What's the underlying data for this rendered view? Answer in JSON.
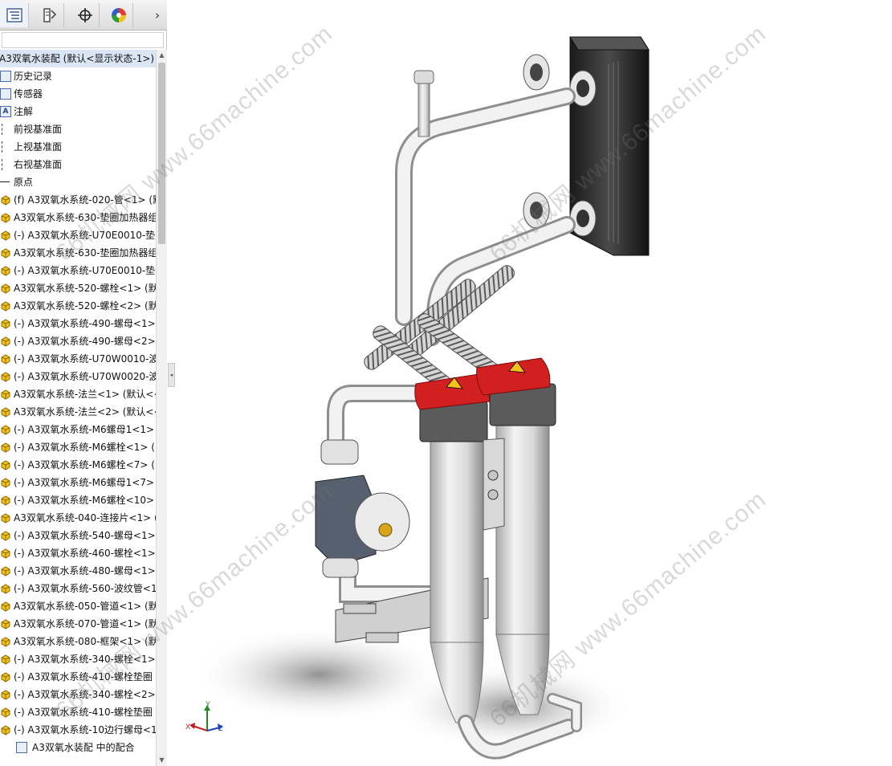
{
  "toolbar": {
    "buttons": [
      {
        "name": "feature-manager-tab",
        "icon": "tree-list-icon"
      },
      {
        "name": "property-manager-tab",
        "icon": "property-icon"
      },
      {
        "name": "configuration-manager-tab",
        "icon": "crosshair-icon"
      },
      {
        "name": "display-manager-tab",
        "icon": "color-wheel-icon"
      }
    ],
    "more_label": "›"
  },
  "tree": {
    "root": "A3双氧水装配  (默认<显示状态-1>)",
    "items": [
      {
        "icon": "history",
        "label": "历史记录"
      },
      {
        "icon": "sensor",
        "label": "传感器"
      },
      {
        "icon": "annotation",
        "label": "注解"
      },
      {
        "icon": "plane",
        "label": "前视基准面"
      },
      {
        "icon": "plane",
        "label": "上视基准面"
      },
      {
        "icon": "plane",
        "label": "右视基准面"
      },
      {
        "icon": "origin",
        "label": "原点"
      },
      {
        "icon": "part",
        "label": "(f) A3双氧水系统-020-管<1> (默"
      },
      {
        "icon": "part",
        "label": "A3双氧水系统-630-垫圈加热器组"
      },
      {
        "icon": "part",
        "label": "(-) A3双氧水系统-U70E0010-垫"
      },
      {
        "icon": "part",
        "label": "A3双氧水系统-630-垫圈加热器组"
      },
      {
        "icon": "part",
        "label": "(-) A3双氧水系统-U70E0010-垫"
      },
      {
        "icon": "part",
        "label": "A3双氧水系统-520-螺栓<1> (默"
      },
      {
        "icon": "part",
        "label": "A3双氧水系统-520-螺栓<2> (默"
      },
      {
        "icon": "part",
        "label": "(-) A3双氧水系统-490-螺母<1>"
      },
      {
        "icon": "part",
        "label": "(-) A3双氧水系统-490-螺母<2>"
      },
      {
        "icon": "part",
        "label": "(-) A3双氧水系统-U70W0010-波"
      },
      {
        "icon": "part",
        "label": "(-) A3双氧水系统-U70W0020-波"
      },
      {
        "icon": "part",
        "label": "A3双氧水系统-法兰<1> (默认<<"
      },
      {
        "icon": "part",
        "label": "A3双氧水系统-法兰<2> (默认<<"
      },
      {
        "icon": "part",
        "label": "(-) A3双氧水系统-M6螺母1<1>"
      },
      {
        "icon": "part",
        "label": "(-) A3双氧水系统-M6螺栓<1> ("
      },
      {
        "icon": "part",
        "label": "(-) A3双氧水系统-M6螺栓<7> ("
      },
      {
        "icon": "part",
        "label": "(-) A3双氧水系统-M6螺母1<7>"
      },
      {
        "icon": "part",
        "label": "(-) A3双氧水系统-M6螺栓<10>"
      },
      {
        "icon": "part",
        "label": "A3双氧水系统-040-连接片<1> ("
      },
      {
        "icon": "part",
        "label": "(-) A3双氧水系统-540-螺母<1>"
      },
      {
        "icon": "part",
        "label": "(-) A3双氧水系统-460-螺栓<1>"
      },
      {
        "icon": "part",
        "label": "(-) A3双氧水系统-480-螺母<1>"
      },
      {
        "icon": "part",
        "label": "(-) A3双氧水系统-560-波纹管<1"
      },
      {
        "icon": "part",
        "label": "A3双氧水系统-050-管道<1> (默"
      },
      {
        "icon": "part",
        "label": "A3双氧水系统-070-管道<1> (默"
      },
      {
        "icon": "part",
        "label": "A3双氧水系统-080-框架<1> (默"
      },
      {
        "icon": "part",
        "label": "(-) A3双氧水系统-340-螺栓<1>"
      },
      {
        "icon": "part",
        "label": "(-) A3双氧水系统-410-螺栓垫圈"
      },
      {
        "icon": "part",
        "label": "(-) A3双氧水系统-340-螺栓<2>"
      },
      {
        "icon": "part",
        "label": "(-) A3双氧水系统-410-螺栓垫圈"
      },
      {
        "icon": "part",
        "label": "(-) A3双氧水系统-10边行螺母<1"
      }
    ],
    "mates": "A3双氧水装配 中的配合"
  },
  "watermark": "66机械网 www.66machine.com",
  "triad": {
    "x": "X",
    "y": "Y",
    "z": "Z"
  },
  "colors": {
    "accent": "#dbe6f5",
    "heater_red": "#d21f1f",
    "part_yellow": "#f2c21a"
  }
}
